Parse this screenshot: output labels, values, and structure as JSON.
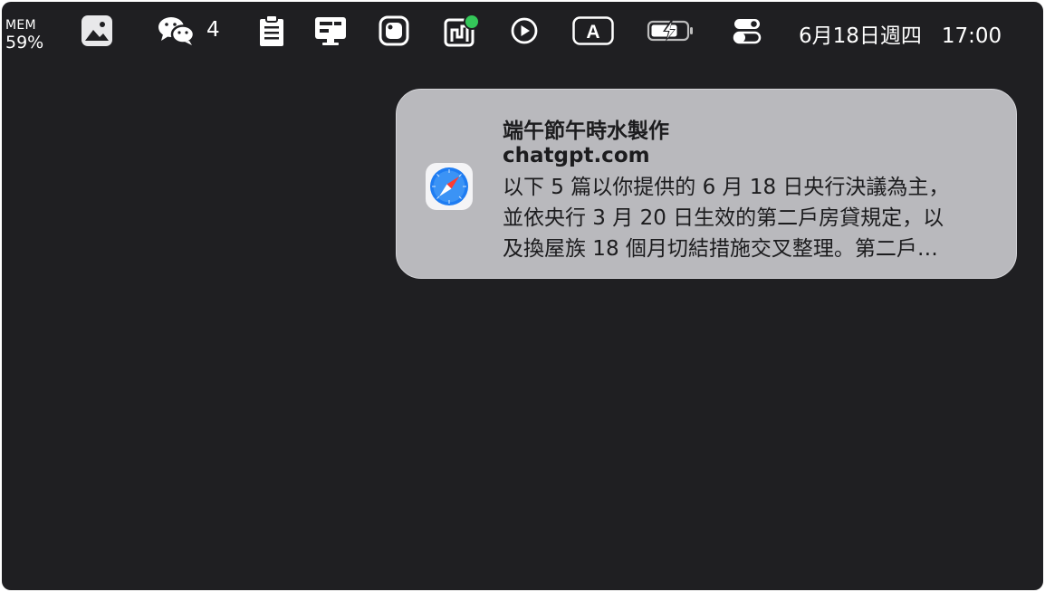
{
  "menubar": {
    "memory": {
      "label": "MEM",
      "value": "59%"
    },
    "wechat_badge": "4",
    "icons": [
      "photos-icon",
      "wechat-icon",
      "clipboard-icon",
      "display-icon",
      "app-square-icon",
      "activity-monitor-icon",
      "play-circle-icon",
      "input-source-icon",
      "battery-charging-icon",
      "control-center-icon"
    ],
    "input_source_letter": "A",
    "date": "6月18日週四",
    "time": "17:00"
  },
  "notification": {
    "app_icon": "safari-icon",
    "title": "端午節午時水製作",
    "subtitle": "chatgpt.com",
    "body_lines": [
      "以下 5 篇以你提供的 6 月 18 日央行決議為主，",
      "並依央行 3 月 20 日生效的第二戶房貸規定，以",
      "及換屋族 18 個月切結措施交叉整理。第二戶…"
    ]
  },
  "colors": {
    "desktop_background": "#1f1f22",
    "notification_background": "#b9b9bd",
    "status_green": "#34c759",
    "safari_blue": "#1e7cf2"
  }
}
